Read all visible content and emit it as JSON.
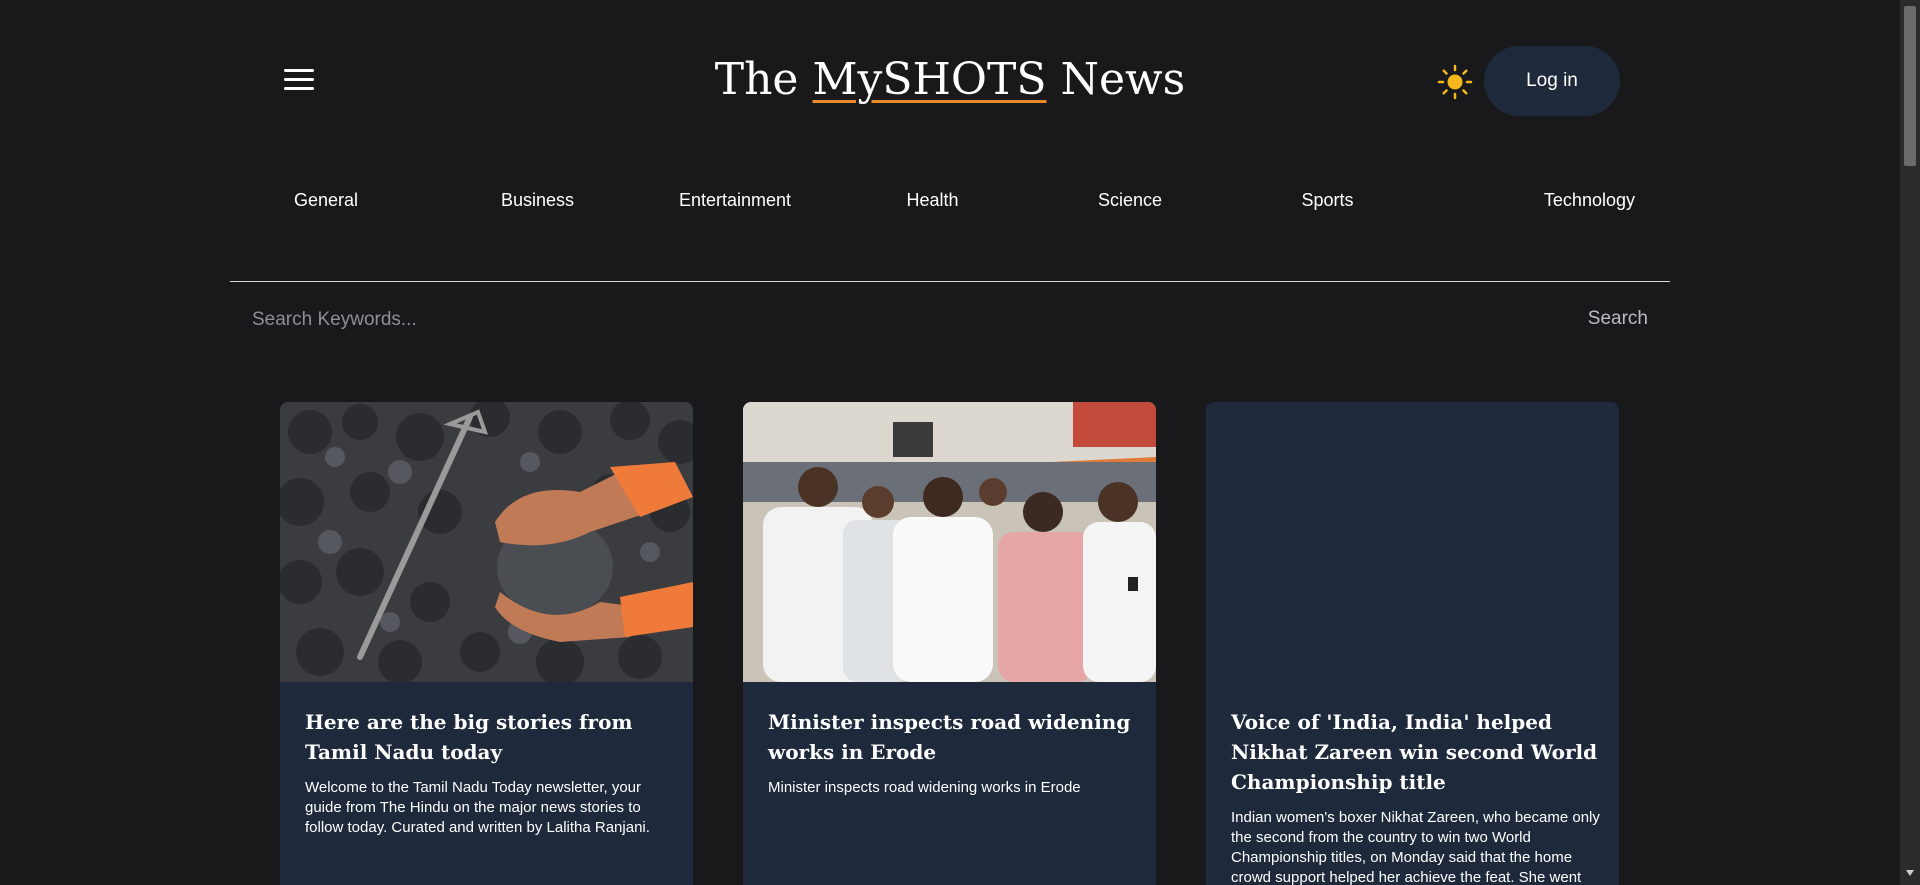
{
  "header": {
    "logo_prefix": "The ",
    "logo_brand": "MySHOTS",
    "logo_suffix": " News",
    "login_label": "Log in",
    "theme_icon": "sun-icon",
    "menu_icon": "hamburger-menu-icon"
  },
  "nav": {
    "items": [
      "General",
      "Business",
      "Entertainment",
      "Health",
      "Science",
      "Sports",
      "Technology"
    ]
  },
  "search": {
    "placeholder": "Search Keywords...",
    "button_label": "Search"
  },
  "cards": [
    {
      "title": "Here are the big stories from Tamil Nadu today",
      "description": "Welcome to the Tamil Nadu Today newsletter, your guide from The Hindu on the major news stories to follow today. Curated and written by Lalitha Ranjani."
    },
    {
      "title": "Minister inspects road widening works in Erode",
      "description": "Minister inspects road widening works in Erode"
    },
    {
      "title": "Voice of 'India, India' helped Nikhat Zareen win second World Championship title",
      "description": "Indian women's boxer Nikhat Zareen, who became only the second from the country to win two World Championship titles, on Monday said that the home crowd support helped her achieve the feat. She went"
    }
  ],
  "colors": {
    "background": "#19191b",
    "card": "#1e293b",
    "accent_underline": "#e88a2e",
    "sun": "#f5b81c"
  }
}
